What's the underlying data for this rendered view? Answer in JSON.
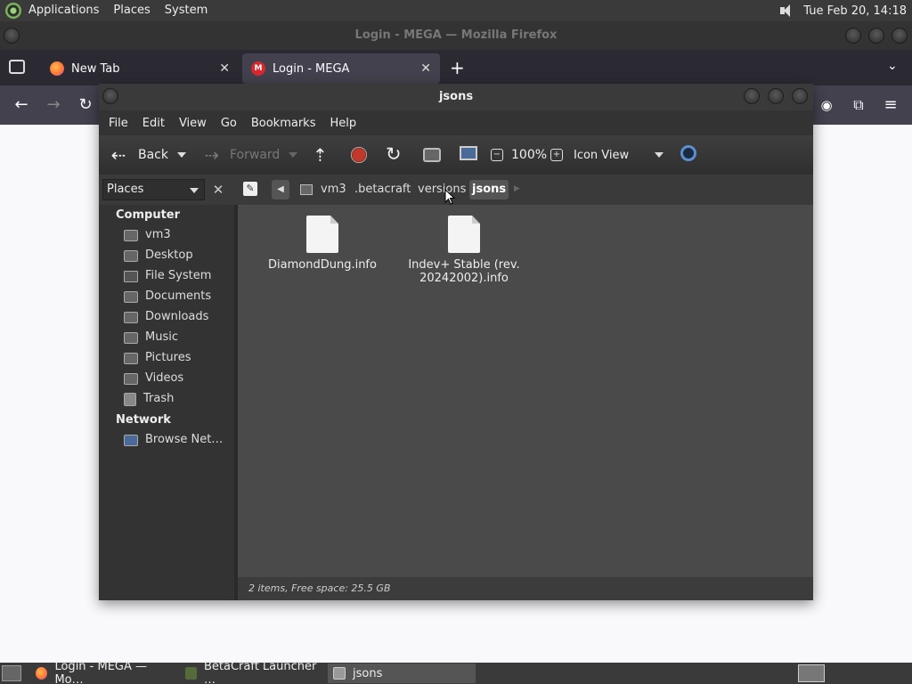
{
  "top_panel": {
    "menus": [
      "Applications",
      "Places",
      "System"
    ],
    "clock": "Tue Feb 20, 14:18"
  },
  "firefox": {
    "window_title": "Login - MEGA — Mozilla Firefox",
    "tabs": [
      {
        "label": "New Tab"
      },
      {
        "label": "Login - MEGA"
      }
    ]
  },
  "caja": {
    "title": "jsons",
    "menubar": [
      "File",
      "Edit",
      "View",
      "Go",
      "Bookmarks",
      "Help"
    ],
    "toolbar": {
      "back": "Back",
      "forward": "Forward",
      "zoom": "100%",
      "view_mode": "Icon View"
    },
    "places_header": "Places",
    "breadcrumbs": [
      "vm3",
      ".betacraft",
      "versions",
      "jsons"
    ],
    "sidebar": {
      "computer_header": "Computer",
      "computer_items": [
        "vm3",
        "Desktop",
        "File System",
        "Documents",
        "Downloads",
        "Music",
        "Pictures",
        "Videos",
        "Trash"
      ],
      "network_header": "Network",
      "network_items": [
        "Browse Net…"
      ]
    },
    "files": [
      {
        "name": "DiamondDung.info"
      },
      {
        "name": "Indev+ Stable (rev. 20242002).info"
      }
    ],
    "status": "2 items, Free space: 25.5 GB"
  },
  "taskbar": {
    "tasks": [
      "Login - MEGA — Mo…",
      "BetaCraft Launcher …",
      "jsons"
    ]
  },
  "colors": {
    "panel_bg": "#3a3a3a",
    "file_pane_bg": "#4a4a4a",
    "firefox_tab_active": "#42414d",
    "mega_red": "#d9272e",
    "stop_red": "#c0392b"
  }
}
